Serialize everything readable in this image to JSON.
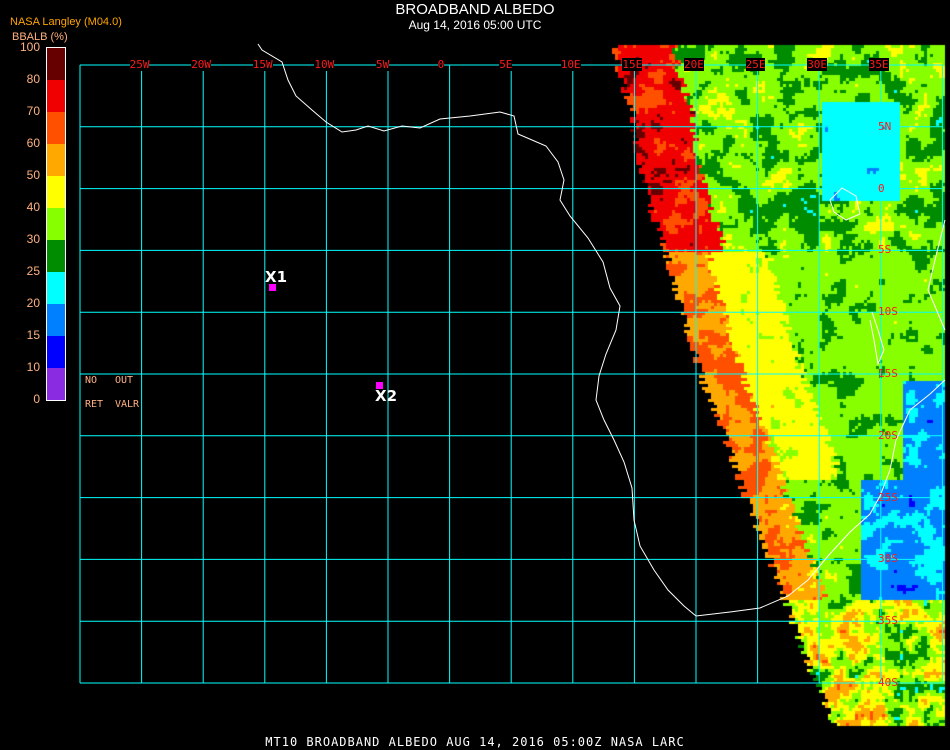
{
  "header": {
    "title": "BROADBAND ALBEDO",
    "subtitle": "Aug 14, 2016 05:00 UTC",
    "source": "NASA Langley (M04.0)"
  },
  "legend": {
    "title": "BBALB (%)",
    "ticks": [
      "100",
      "80",
      "70",
      "60",
      "50",
      "40",
      "30",
      "25",
      "20",
      "15",
      "10",
      "0"
    ],
    "colors": [
      "#660000",
      "#f00000",
      "#ff5000",
      "#ffa800",
      "#ffff00",
      "#88ff00",
      "#008c00",
      "#00ffff",
      "#0080ff",
      "#0000ff",
      "#8a2be2"
    ],
    "no_ret": "NO",
    "no_ret2": "RET",
    "out_valr": "OUT",
    "out_valr2": "VALR"
  },
  "map": {
    "lon_labels": [
      "25W",
      "20W",
      "15W",
      "10W",
      "5W",
      "0",
      "5E",
      "10E",
      "15E",
      "20E",
      "25E",
      "30E",
      "35E"
    ],
    "lat_labels": [
      "5N",
      "0",
      "5S",
      "10S",
      "15S",
      "20S",
      "25S",
      "30S",
      "35S",
      "40S"
    ],
    "grid_color": "#00ffff",
    "markers": [
      {
        "label": "X1"
      },
      {
        "label": "X2"
      }
    ]
  },
  "footer": "MT10  BROADBAND ALBEDO   AUG 14, 2016 05:00Z   NASA LARC"
}
